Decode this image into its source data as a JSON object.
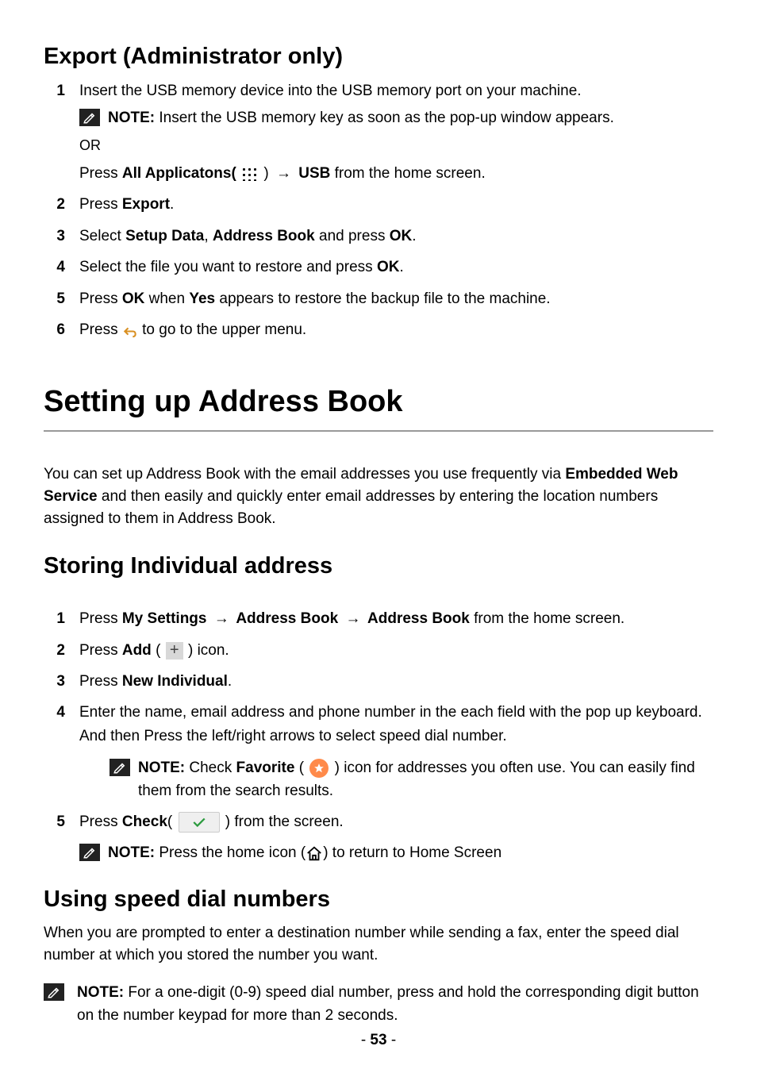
{
  "export": {
    "heading": "Export (Administrator only)",
    "step1": "Insert the USB memory device into the USB memory port on your machine.",
    "note1_label": "NOTE:",
    "note1_text": " Insert the USB memory key as soon as the pop-up window appears.",
    "or": "OR",
    "step1b_a": "Press ",
    "step1b_b": "All Applicatons(",
    "step1b_c": " )",
    "step1b_arrow": "→",
    "step1b_d": " USB",
    "step1b_e": " from the home screen.",
    "step2_a": "Press ",
    "step2_b": "Export",
    "step2_c": ".",
    "step3_a": "Select ",
    "step3_b": "Setup Data",
    "step3_c": ", ",
    "step3_d": "Address Book",
    "step3_e": " and press ",
    "step3_f": "OK",
    "step3_g": ".",
    "step4_a": "Select the file you want to restore and press ",
    "step4_b": "OK",
    "step4_c": ".",
    "step5_a": "Press ",
    "step5_b": "OK",
    "step5_c": " when ",
    "step5_d": "Yes",
    "step5_e": " appears to restore the backup file to the machine.",
    "step6_a": "Press ",
    "step6_b": " to go to the upper menu."
  },
  "addressbook": {
    "title": "Setting up Address Book",
    "intro_a": "You can set up Address Book with the email addresses you use frequently via ",
    "intro_b": "Embedded Web Service",
    "intro_c": " and then easily and quickly enter email addresses by entering the location numbers assigned to them in Address Book."
  },
  "storing": {
    "heading": "Storing Individual address",
    "step1_a": "Press ",
    "step1_b": "My Settings",
    "step1_arrow": "→",
    "step1_c": " Address Book ",
    "step1_d": " Address Book",
    "step1_e": " from the home screen.",
    "step2_a": "Press ",
    "step2_b": "Add",
    "step2_c": " ( ",
    "step2_d": " ) icon.",
    "step3_a": "Press ",
    "step3_b": "New Individual",
    "step3_c": ".",
    "step4": "Enter the name, email address and phone number in the each field with the pop up keyboard. And then Press the left/right arrows to select speed dial number.",
    "note4_label": "NOTE:",
    "note4_a": " Check ",
    "note4_b": "Favorite",
    "note4_c": " ( ",
    "note4_d": " ) icon for addresses you often use. You can easily find them from the search results.",
    "step5_a": "Press ",
    "step5_b": "Check",
    "step5_c": "( ",
    "step5_d": " ) from the screen.",
    "note5_label": "NOTE:",
    "note5_a": " Press the home icon (",
    "note5_b": ") to return to Home Screen"
  },
  "speeddial": {
    "heading": "Using speed dial numbers",
    "intro": "When you are prompted to enter a destination number while sending a fax, enter the speed dial number at which you stored the number you want.",
    "note_label": "NOTE:",
    "note_text": " For a one-digit (0-9) speed dial number, press and hold the corresponding digit button on the number keypad for more than 2 seconds."
  },
  "page": {
    "prefix": "- ",
    "num": "53",
    "suffix": " -"
  }
}
